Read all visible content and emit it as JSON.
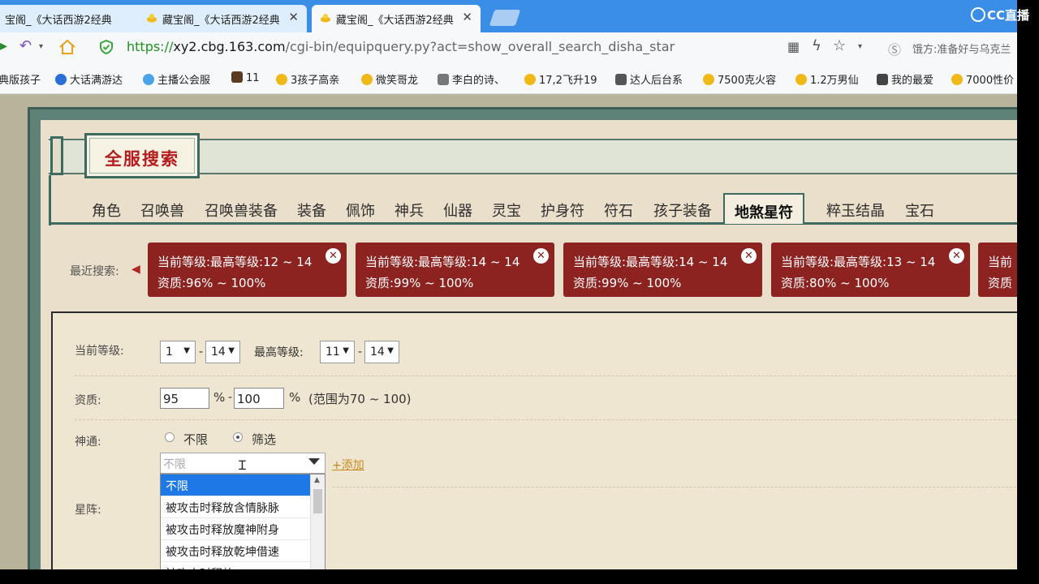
{
  "browser": {
    "tabs": [
      {
        "title": "宝阁_《大话西游2经典",
        "close": "✕"
      },
      {
        "title": "藏宝阁_《大话西游2经典",
        "close": "✕"
      },
      {
        "title": "藏宝阁_《大话西游2经典",
        "close": "✕"
      }
    ],
    "url_scheme": "https://",
    "url_host": "xy2.cbg.163.com",
    "url_path": "/cgi-bin/equipquery.py?act=show_overall_search_disha_star",
    "address_right_text": "饿方:准备好与乌克兰",
    "bookmarks": [
      "典版孩子",
      "大话满游达",
      "主播公会服",
      "11",
      "3孩子高亲",
      "微笑哥龙",
      "李白的诗、",
      "17,2飞升19",
      "达人后台系",
      "7500克火容",
      "1.2万男仙",
      "我的最爱",
      "7000性价"
    ]
  },
  "overlay_logo": "CC直播",
  "page": {
    "title": "全服搜索",
    "category_tabs": [
      "角色",
      "召唤兽",
      "召唤兽装备",
      "装备",
      "佩饰",
      "神兵",
      "仙器",
      "灵宝",
      "护身符",
      "符石",
      "孩子装备",
      "地煞星符",
      "粹玉结晶",
      "宝石"
    ],
    "recent_label": "最近搜索:",
    "recent_searches": [
      {
        "line1": "当前等级:最高等级:12 ~ 14",
        "line2": "资质:96% ~ 100%"
      },
      {
        "line1": "当前等级:最高等级:14 ~ 14",
        "line2": "资质:99% ~ 100%"
      },
      {
        "line1": "当前等级:最高等级:14 ~ 14",
        "line2": "资质:99% ~ 100%"
      },
      {
        "line1": "当前等级:最高等级:13 ~ 14",
        "line2": "资质:80% ~ 100%"
      },
      {
        "line1": "当前",
        "line2": "资质"
      }
    ],
    "form": {
      "level_label": "当前等级:",
      "level_min": "1",
      "level_max": "14",
      "max_level_label": "最高等级:",
      "max_level_min": "11",
      "max_level_max": "14",
      "dash": "-",
      "quality_label": "资质:",
      "quality_min": "95",
      "quality_max": "100",
      "percent": "%",
      "quality_hint": "(范围为70 ~ 100)",
      "shentong_label": "神通:",
      "radio_unlimited": "不限",
      "radio_filter": "筛选",
      "combo_placeholder": "不限",
      "add_link": "+添加",
      "xingzhen_label": "星阵:",
      "dropdown_options": [
        "不限",
        "被攻击时释放含情脉脉",
        "被攻击时释放魔神附身",
        "被攻击时释放乾坤借速",
        "被攻击时释放"
      ]
    }
  }
}
